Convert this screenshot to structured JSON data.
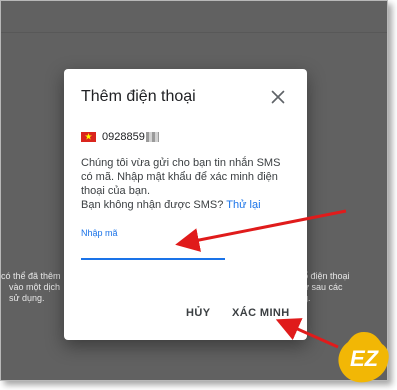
{
  "background": {
    "left_lines": [
      "có thể đã thêm",
      "vào một dịch",
      "sử dụng."
    ],
    "right_lines": [
      "ố điện thoại",
      "ử sau các",
      "g."
    ]
  },
  "dialog": {
    "title": "Thêm điện thoại",
    "close_icon": "close-icon",
    "phone_prefix": "0928859",
    "flag": "vietnam-flag",
    "message_lines": [
      "Chúng tôi vừa gửi cho bạn tin nhắn SMS",
      "có mã. Nhập mật khẩu để xác minh điện",
      "thoại của bạn."
    ],
    "resend_prompt": "Bạn không nhận được SMS?",
    "resend_link": "Thử lại",
    "code_label": "Nhập mã",
    "code_value": "",
    "cancel_label": "HỦY",
    "verify_label": "XÁC MINH"
  },
  "watermark": {
    "text": "EZ"
  },
  "colors": {
    "accent": "#1a73e8",
    "annotation_arrow": "#e01b1b",
    "logo_yellow": "#f2b705",
    "flag_red": "#da251d",
    "flag_star": "#ffff00"
  }
}
